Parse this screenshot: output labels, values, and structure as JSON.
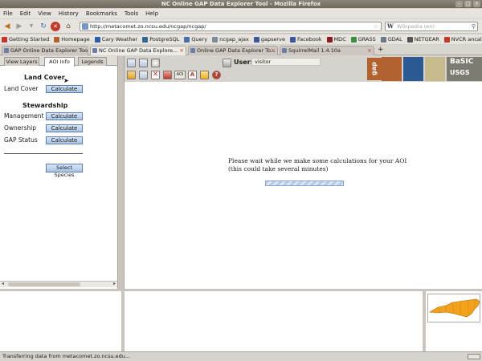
{
  "window": {
    "title": "NC Online GAP Data Explorer Tool - Mozilla Firefox"
  },
  "menu": [
    "File",
    "Edit",
    "View",
    "History",
    "Bookmarks",
    "Tools",
    "Help"
  ],
  "nav": {
    "url": "http://metacomet.zo.ncsu.edu/ncgap/ncgap/",
    "search_placeholder": "Wikipedia (en)"
  },
  "bookmarks": [
    {
      "label": "Getting Started",
      "color": "#c0392b"
    },
    {
      "label": "Homepage",
      "color": "#b2622f"
    },
    {
      "label": "Cary Weather",
      "color": "#2a5caa"
    },
    {
      "label": "PostgreSQL",
      "color": "#336791"
    },
    {
      "label": "Query",
      "color": "#4a6fa5"
    },
    {
      "label": "ncgap_ajax",
      "color": "#7e8c99"
    },
    {
      "label": "gapserve",
      "color": "#3b5998"
    },
    {
      "label": "Facebook",
      "color": "#3b5998"
    },
    {
      "label": "MDC",
      "color": "#8b1a1a"
    },
    {
      "label": "GRASS",
      "color": "#3e8e41"
    },
    {
      "label": "GDAL",
      "color": "#6c7a89"
    },
    {
      "label": "NETGEAR",
      "color": "#555555"
    },
    {
      "label": "NVCR ancalagon",
      "color": "#c0392b"
    }
  ],
  "tabs": [
    {
      "label": "GAP Online Data Explorer Tool"
    },
    {
      "label": "NC Online GAP Data Explore..."
    },
    {
      "label": "Online GAP Data Explorer To..."
    },
    {
      "label": "SquirrelMail 1.4.10a"
    }
  ],
  "left_tabs": [
    "View Layers",
    "AOI Info",
    "Legends"
  ],
  "aoi_info": {
    "land_cover_heading": "Land Cover",
    "land_cover_label": "Land Cover",
    "stewardship_heading": "Stewardship",
    "management_label": "Management",
    "ownership_label": "Ownership",
    "gap_status_label": "GAP Status",
    "calculate": "Calculate",
    "select_species": "Select Species"
  },
  "toolbar": {
    "user_label": "User:",
    "user_value": "visitor",
    "aoi_label": "AOI",
    "gap_logo": "gap",
    "basic_line1": "BaSIC",
    "basic_line2": "USGS"
  },
  "main": {
    "wait_line1": "Please wait while we make some calculations for your AOI",
    "wait_line2": "(this could take several minutes)"
  },
  "status": "Transferring data from metacomet.zo.ncsu.edu..."
}
